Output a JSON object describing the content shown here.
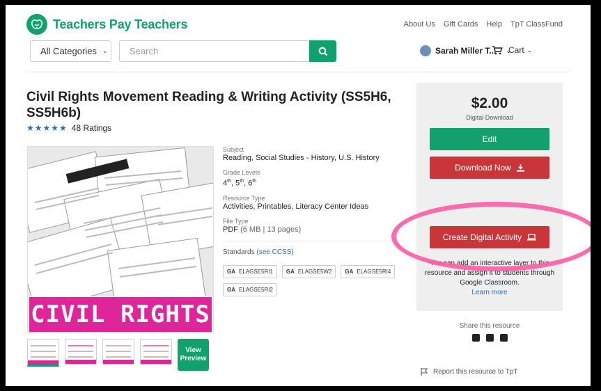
{
  "header": {
    "brand": "Teachers Pay Teachers",
    "top_links": [
      "About Us",
      "Gift Cards",
      "Help",
      "TpT ClassFund"
    ],
    "category": "All Categories",
    "search_placeholder": "Search",
    "user_name": "Sarah Miller T...",
    "cart_label": "Cart"
  },
  "product": {
    "title": "Civil Rights Movement Reading & Writing Activity (SS5H6, SS5H6b)",
    "ratings": "48 Ratings",
    "image_banner": "CIVIL RIGHTS",
    "view_preview": "View Preview",
    "subject_label": "Subject",
    "subject": "Reading, Social Studies - History, U.S. History",
    "grade_label": "Grade Levels",
    "grades": [
      "4",
      "5",
      "6"
    ],
    "grade_suffix": "th",
    "type_label": "Resource Type",
    "type": "Activities, Printables, Literacy Center Ideas",
    "file_label": "File Type",
    "file_type": "PDF",
    "file_info": "(6 MB | 13 pages)",
    "standards_label": "Standards",
    "standards_link": "(see CCSS)",
    "standards": [
      {
        "state": "GA",
        "code": "ELAGSE5RI1"
      },
      {
        "state": "GA",
        "code": "ELAGSE5W2"
      },
      {
        "state": "GA",
        "code": "ELAGSE5RI4"
      },
      {
        "state": "GA",
        "code": "ELAGSE5RI2"
      }
    ]
  },
  "purchase": {
    "price": "$2.00",
    "price_type": "Digital Download",
    "edit_label": "Edit",
    "download_label": "Download Now",
    "digital_label": "Create Digital Activity",
    "digital_info": "You can add an interactive layer to this resource and assign it to students through Google Classroom.",
    "learn_more": "Learn more",
    "share_label": "Share this resource",
    "report_label": "Report this resource to TpT"
  },
  "colors": {
    "brand": "#12a06d",
    "danger": "#c8363a",
    "highlight": "#ff5fa7",
    "banner": "#e0249a"
  }
}
